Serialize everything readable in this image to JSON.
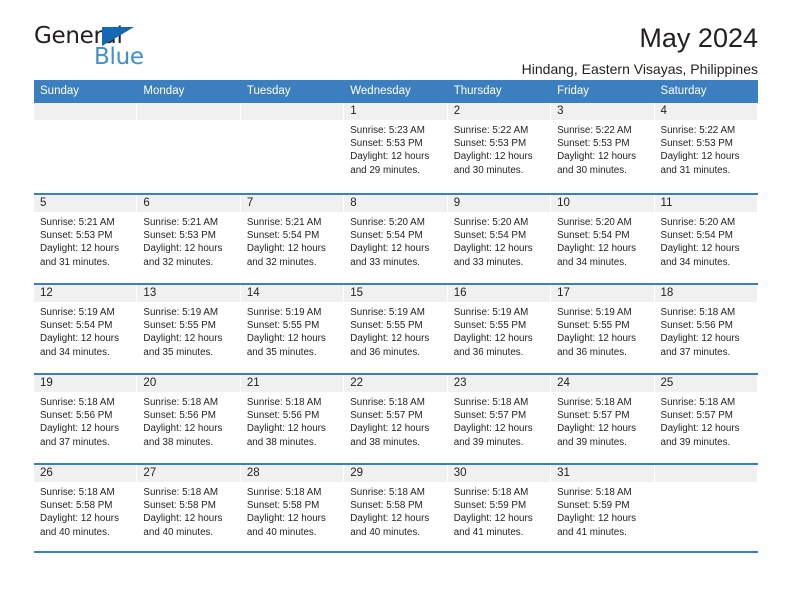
{
  "brand": {
    "name_part1": "General",
    "name_part2": "Blue",
    "triangle_color": "#1268b3",
    "blue_color": "#3f8fd2"
  },
  "header": {
    "title": "May 2024",
    "subtitle": "Hindang, Eastern Visayas, Philippines"
  },
  "theme": {
    "header_bg": "#3c7fc0",
    "header_text": "#ffffff",
    "daynum_bg": "#f0f0f0",
    "cell_bg": "#ffffff",
    "text": "#231f20"
  },
  "weekdays": [
    "Sunday",
    "Monday",
    "Tuesday",
    "Wednesday",
    "Thursday",
    "Friday",
    "Saturday"
  ],
  "weeks": [
    [
      {
        "day": "",
        "sunrise": "",
        "sunset": "",
        "daylight": ""
      },
      {
        "day": "",
        "sunrise": "",
        "sunset": "",
        "daylight": ""
      },
      {
        "day": "",
        "sunrise": "",
        "sunset": "",
        "daylight": ""
      },
      {
        "day": "1",
        "sunrise": "Sunrise: 5:23 AM",
        "sunset": "Sunset: 5:53 PM",
        "daylight": "Daylight: 12 hours and 29 minutes."
      },
      {
        "day": "2",
        "sunrise": "Sunrise: 5:22 AM",
        "sunset": "Sunset: 5:53 PM",
        "daylight": "Daylight: 12 hours and 30 minutes."
      },
      {
        "day": "3",
        "sunrise": "Sunrise: 5:22 AM",
        "sunset": "Sunset: 5:53 PM",
        "daylight": "Daylight: 12 hours and 30 minutes."
      },
      {
        "day": "4",
        "sunrise": "Sunrise: 5:22 AM",
        "sunset": "Sunset: 5:53 PM",
        "daylight": "Daylight: 12 hours and 31 minutes."
      }
    ],
    [
      {
        "day": "5",
        "sunrise": "Sunrise: 5:21 AM",
        "sunset": "Sunset: 5:53 PM",
        "daylight": "Daylight: 12 hours and 31 minutes."
      },
      {
        "day": "6",
        "sunrise": "Sunrise: 5:21 AM",
        "sunset": "Sunset: 5:53 PM",
        "daylight": "Daylight: 12 hours and 32 minutes."
      },
      {
        "day": "7",
        "sunrise": "Sunrise: 5:21 AM",
        "sunset": "Sunset: 5:54 PM",
        "daylight": "Daylight: 12 hours and 32 minutes."
      },
      {
        "day": "8",
        "sunrise": "Sunrise: 5:20 AM",
        "sunset": "Sunset: 5:54 PM",
        "daylight": "Daylight: 12 hours and 33 minutes."
      },
      {
        "day": "9",
        "sunrise": "Sunrise: 5:20 AM",
        "sunset": "Sunset: 5:54 PM",
        "daylight": "Daylight: 12 hours and 33 minutes."
      },
      {
        "day": "10",
        "sunrise": "Sunrise: 5:20 AM",
        "sunset": "Sunset: 5:54 PM",
        "daylight": "Daylight: 12 hours and 34 minutes."
      },
      {
        "day": "11",
        "sunrise": "Sunrise: 5:20 AM",
        "sunset": "Sunset: 5:54 PM",
        "daylight": "Daylight: 12 hours and 34 minutes."
      }
    ],
    [
      {
        "day": "12",
        "sunrise": "Sunrise: 5:19 AM",
        "sunset": "Sunset: 5:54 PM",
        "daylight": "Daylight: 12 hours and 34 minutes."
      },
      {
        "day": "13",
        "sunrise": "Sunrise: 5:19 AM",
        "sunset": "Sunset: 5:55 PM",
        "daylight": "Daylight: 12 hours and 35 minutes."
      },
      {
        "day": "14",
        "sunrise": "Sunrise: 5:19 AM",
        "sunset": "Sunset: 5:55 PM",
        "daylight": "Daylight: 12 hours and 35 minutes."
      },
      {
        "day": "15",
        "sunrise": "Sunrise: 5:19 AM",
        "sunset": "Sunset: 5:55 PM",
        "daylight": "Daylight: 12 hours and 36 minutes."
      },
      {
        "day": "16",
        "sunrise": "Sunrise: 5:19 AM",
        "sunset": "Sunset: 5:55 PM",
        "daylight": "Daylight: 12 hours and 36 minutes."
      },
      {
        "day": "17",
        "sunrise": "Sunrise: 5:19 AM",
        "sunset": "Sunset: 5:55 PM",
        "daylight": "Daylight: 12 hours and 36 minutes."
      },
      {
        "day": "18",
        "sunrise": "Sunrise: 5:18 AM",
        "sunset": "Sunset: 5:56 PM",
        "daylight": "Daylight: 12 hours and 37 minutes."
      }
    ],
    [
      {
        "day": "19",
        "sunrise": "Sunrise: 5:18 AM",
        "sunset": "Sunset: 5:56 PM",
        "daylight": "Daylight: 12 hours and 37 minutes."
      },
      {
        "day": "20",
        "sunrise": "Sunrise: 5:18 AM",
        "sunset": "Sunset: 5:56 PM",
        "daylight": "Daylight: 12 hours and 38 minutes."
      },
      {
        "day": "21",
        "sunrise": "Sunrise: 5:18 AM",
        "sunset": "Sunset: 5:56 PM",
        "daylight": "Daylight: 12 hours and 38 minutes."
      },
      {
        "day": "22",
        "sunrise": "Sunrise: 5:18 AM",
        "sunset": "Sunset: 5:57 PM",
        "daylight": "Daylight: 12 hours and 38 minutes."
      },
      {
        "day": "23",
        "sunrise": "Sunrise: 5:18 AM",
        "sunset": "Sunset: 5:57 PM",
        "daylight": "Daylight: 12 hours and 39 minutes."
      },
      {
        "day": "24",
        "sunrise": "Sunrise: 5:18 AM",
        "sunset": "Sunset: 5:57 PM",
        "daylight": "Daylight: 12 hours and 39 minutes."
      },
      {
        "day": "25",
        "sunrise": "Sunrise: 5:18 AM",
        "sunset": "Sunset: 5:57 PM",
        "daylight": "Daylight: 12 hours and 39 minutes."
      }
    ],
    [
      {
        "day": "26",
        "sunrise": "Sunrise: 5:18 AM",
        "sunset": "Sunset: 5:58 PM",
        "daylight": "Daylight: 12 hours and 40 minutes."
      },
      {
        "day": "27",
        "sunrise": "Sunrise: 5:18 AM",
        "sunset": "Sunset: 5:58 PM",
        "daylight": "Daylight: 12 hours and 40 minutes."
      },
      {
        "day": "28",
        "sunrise": "Sunrise: 5:18 AM",
        "sunset": "Sunset: 5:58 PM",
        "daylight": "Daylight: 12 hours and 40 minutes."
      },
      {
        "day": "29",
        "sunrise": "Sunrise: 5:18 AM",
        "sunset": "Sunset: 5:58 PM",
        "daylight": "Daylight: 12 hours and 40 minutes."
      },
      {
        "day": "30",
        "sunrise": "Sunrise: 5:18 AM",
        "sunset": "Sunset: 5:59 PM",
        "daylight": "Daylight: 12 hours and 41 minutes."
      },
      {
        "day": "31",
        "sunrise": "Sunrise: 5:18 AM",
        "sunset": "Sunset: 5:59 PM",
        "daylight": "Daylight: 12 hours and 41 minutes."
      },
      {
        "day": "",
        "sunrise": "",
        "sunset": "",
        "daylight": ""
      }
    ]
  ]
}
